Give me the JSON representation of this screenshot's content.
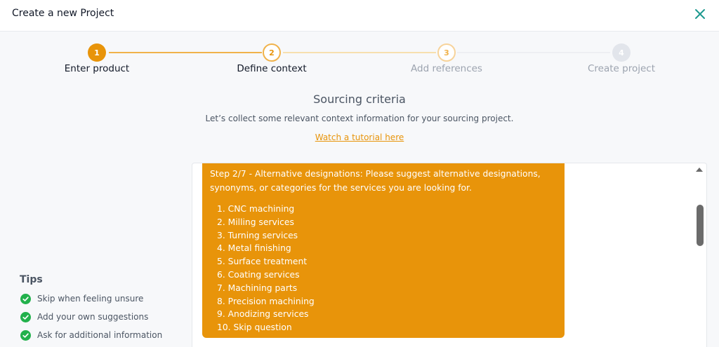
{
  "header": {
    "title": "Create a new Project",
    "close_icon": "close-icon"
  },
  "stepper": {
    "steps": [
      {
        "number": "1",
        "label": "Enter product",
        "state": "completed"
      },
      {
        "number": "2",
        "label": "Define context",
        "state": "active"
      },
      {
        "number": "3",
        "label": "Add references",
        "state": "upcoming"
      },
      {
        "number": "4",
        "label": "Create project",
        "state": "disabled"
      }
    ]
  },
  "main": {
    "title": "Sourcing criteria",
    "subtitle": "Let’s collect some relevant context information for your sourcing project.",
    "tutorial_link": "Watch a tutorial here"
  },
  "chat": {
    "message_text": "Step 2/7 - Alternative designations: Please suggest alternative designations, synonyms, or categories for the services you are looking for.",
    "options": [
      "1. CNC machining",
      "2. Milling services",
      "3. Turning services",
      "4. Metal finishing",
      "5. Surface treatment",
      "6. Coating services",
      "7. Machining parts",
      "8. Precision machining",
      "9. Anodizing services",
      "10. Skip question"
    ]
  },
  "tips": {
    "title": "Tips",
    "items": [
      "Skip when feeling unsure",
      "Add your own suggestions",
      "Ask for additional information"
    ]
  },
  "colors": {
    "accent": "#e8940a",
    "accent_light": "#f5c778",
    "close": "#1e9a8f",
    "success": "#22b14c",
    "disabled": "#d9dde5"
  }
}
